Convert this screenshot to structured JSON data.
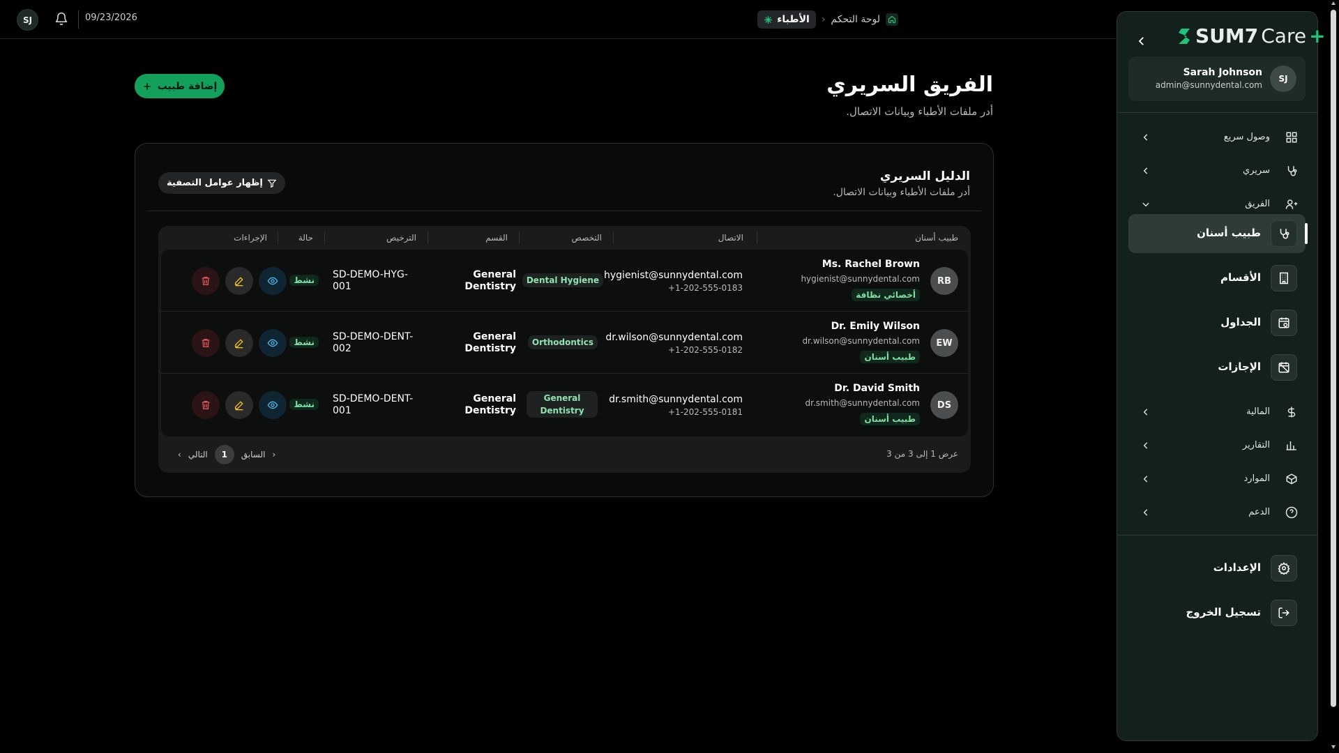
{
  "topbar": {
    "avatar_initials": "SJ",
    "date": "09/23/2026",
    "breadcrumb": {
      "home": "لوحة التحكم",
      "current": "الأطباء"
    }
  },
  "page": {
    "title": "الفريق السريري",
    "subtitle": "أدر ملفات الأطباء وبيانات الاتصال.",
    "add_button": "إضافة طبيب"
  },
  "directory": {
    "title": "الدليل السريري",
    "subtitle": "أدر ملفات الأطباء وبيانات الاتصال.",
    "filter_button": "إظهار عوامل التصفية",
    "columns": {
      "dentist": "طبيب أسنان",
      "contact": "الاتصال",
      "specialty": "التخصص",
      "department": "القسم",
      "license": "الترخيص",
      "status": "حالة",
      "actions": "الإجراءات"
    },
    "rows": [
      {
        "initials": "RB",
        "name": "Ms. Rachel Brown",
        "email": "hygienist@sunnydental.com",
        "role": "أخصائي نظافة",
        "contact_email": "hygienist@sunnydental.com",
        "phone": "+1-202-555-0183",
        "specialty": "Dental Hygiene",
        "department_line1": "General",
        "department_line2": "Dentistry",
        "license_line1": "SD-DEMO-HYG-",
        "license_line2": "001",
        "status": "نشط"
      },
      {
        "initials": "EW",
        "name": "Dr. Emily Wilson",
        "email": "dr.wilson@sunnydental.com",
        "role": "طبيب أسنان",
        "contact_email": "dr.wilson@sunnydental.com",
        "phone": "+1-202-555-0182",
        "specialty": "Orthodontics",
        "department_line1": "General",
        "department_line2": "Dentistry",
        "license_line1": "SD-DEMO-DENT-",
        "license_line2": "002",
        "status": "نشط"
      },
      {
        "initials": "DS",
        "name": "Dr. David Smith",
        "email": "dr.smith@sunnydental.com",
        "role": "طبيب أسنان",
        "contact_email": "dr.smith@sunnydental.com",
        "phone": "+1-202-555-0181",
        "specialty_line1": "General",
        "specialty_line2": "Dentistry",
        "department_line1": "General",
        "department_line2": "Dentistry",
        "license_line1": "SD-DEMO-DENT-",
        "license_line2": "001",
        "status": "نشط"
      }
    ],
    "footer": {
      "showing": "عرض 1 إلى 3 من 3",
      "prev": "السابق",
      "page": "1",
      "next": "التالي"
    }
  },
  "sidebar": {
    "logo_main": "SUM7",
    "logo_care": "Care",
    "logo_plus": "+",
    "user": {
      "initials": "SJ",
      "name": "Sarah Johnson",
      "email": "admin@sunnydental.com"
    },
    "nav": {
      "quick_access": "وصول سريع",
      "clinical": "سريري",
      "team": "الفريق",
      "team_items": {
        "dentist": "طبيب أسنان",
        "departments": "الأقسام",
        "schedules": "الجداول",
        "leaves": "الإجازات"
      },
      "finance": "المالية",
      "reports": "التقارير",
      "resources": "الموارد",
      "support": "الدعم",
      "settings": "الإعدادات",
      "logout": "تسجيل الخروج"
    }
  },
  "colors": {
    "accent": "#13a05b",
    "sidebar_bg": "#14201c",
    "status_text": "#7ee0a6"
  }
}
